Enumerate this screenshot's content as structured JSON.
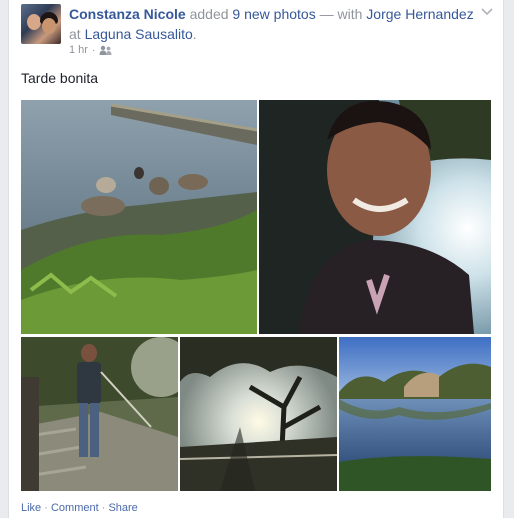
{
  "post": {
    "author": "Constanza Nicole",
    "verb_pre": " added ",
    "photo_count_link": "9 new photos",
    "with_text": " — with ",
    "tagged_person": "Jorge Hernandez",
    "at_text": " at ",
    "location": "Laguna Sausalito",
    "trailing": ".",
    "time": "1 hr",
    "separator": "·",
    "privacy_icon": "friends-icon",
    "caption": "Tarde bonita",
    "photos": [
      {
        "name": "lake-rocks-photo",
        "desc": "lake shore with rocks, pier and ducks"
      },
      {
        "name": "smiling-man-photo",
        "desc": "man smiling by the lake"
      },
      {
        "name": "man-on-bridge-photo",
        "desc": "man standing on wooden bridge"
      },
      {
        "name": "tree-silhouette-photo",
        "desc": "tree silhouette against sun"
      },
      {
        "name": "lagoon-view-photo",
        "desc": "lagoon with trees and blue sky"
      }
    ]
  },
  "actions": {
    "like": "Like",
    "comment": "Comment",
    "share": "Share",
    "dot": " · "
  },
  "colors": {
    "link": "#365899",
    "meta": "#90949c",
    "background": "#e9ebee"
  }
}
